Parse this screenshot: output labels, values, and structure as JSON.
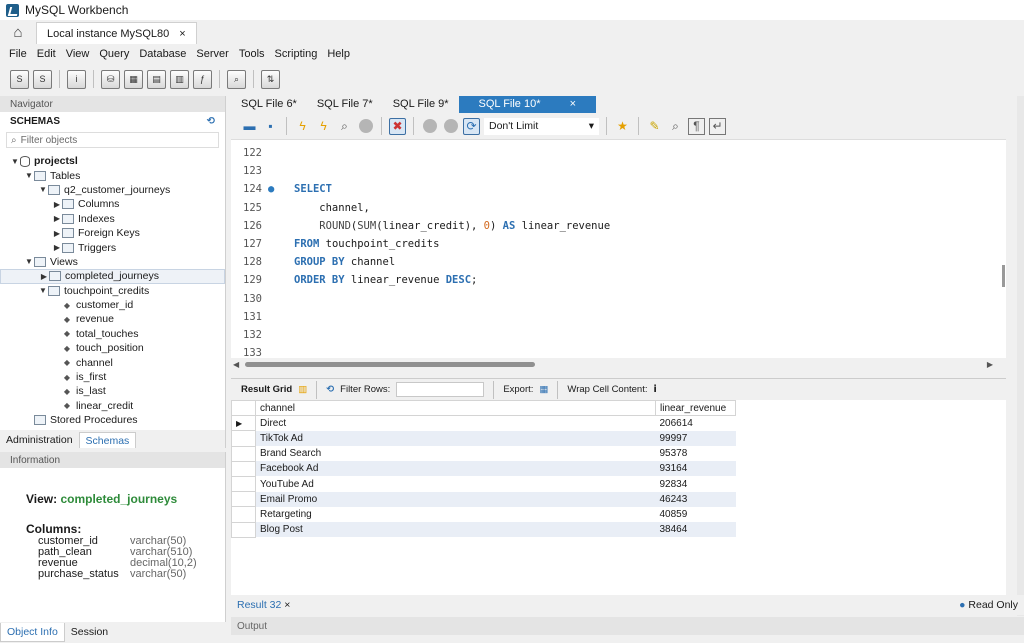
{
  "app": {
    "title": "MySQL Workbench"
  },
  "instance_tab": {
    "label": "Local instance MySQL80",
    "close": "×"
  },
  "menu": [
    "File",
    "Edit",
    "View",
    "Query",
    "Database",
    "Server",
    "Tools",
    "Scripting",
    "Help"
  ],
  "navigator": {
    "header": "Navigator",
    "schemas_label": "SCHEMAS",
    "filter_placeholder": "Filter objects",
    "tree": [
      {
        "label": "projectsl",
        "level": 0,
        "twisty": "▼",
        "icon": "database-icon",
        "bold": true
      },
      {
        "label": "Tables",
        "level": 1,
        "twisty": "▼",
        "icon": "folder-icon"
      },
      {
        "label": "q2_customer_journeys",
        "level": 2,
        "twisty": "▼",
        "icon": "table-icon"
      },
      {
        "label": "Columns",
        "level": 3,
        "twisty": "▶",
        "icon": "folder-icon"
      },
      {
        "label": "Indexes",
        "level": 3,
        "twisty": "▶",
        "icon": "folder-icon"
      },
      {
        "label": "Foreign Keys",
        "level": 3,
        "twisty": "▶",
        "icon": "folder-icon"
      },
      {
        "label": "Triggers",
        "level": 3,
        "twisty": "▶",
        "icon": "folder-icon"
      },
      {
        "label": "Views",
        "level": 1,
        "twisty": "▼",
        "icon": "folder-icon"
      },
      {
        "label": "completed_journeys",
        "level": 2,
        "twisty": "▶",
        "icon": "view-icon",
        "selected": true
      },
      {
        "label": "touchpoint_credits",
        "level": 2,
        "twisty": "▼",
        "icon": "view-icon"
      },
      {
        "label": "customer_id",
        "level": 3,
        "icon": "column-icon"
      },
      {
        "label": "revenue",
        "level": 3,
        "icon": "column-icon"
      },
      {
        "label": "total_touches",
        "level": 3,
        "icon": "column-icon"
      },
      {
        "label": "touch_position",
        "level": 3,
        "icon": "column-icon"
      },
      {
        "label": "channel",
        "level": 3,
        "icon": "column-icon"
      },
      {
        "label": "is_first",
        "level": 3,
        "icon": "column-icon"
      },
      {
        "label": "is_last",
        "level": 3,
        "icon": "column-icon"
      },
      {
        "label": "linear_credit",
        "level": 3,
        "icon": "column-icon"
      },
      {
        "label": "Stored Procedures",
        "level": 1,
        "icon": "folder-icon"
      }
    ],
    "tabs": {
      "administration": "Administration",
      "schemas": "Schemas"
    }
  },
  "information": {
    "header": "Information",
    "view_prefix": "View:",
    "view_name": "completed_journeys",
    "columns_label": "Columns:",
    "columns": [
      {
        "name": "customer_id",
        "type": "varchar(50)"
      },
      {
        "name": "path_clean",
        "type": "varchar(510)"
      },
      {
        "name": "revenue",
        "type": "decimal(10,2)"
      },
      {
        "name": "purchase_status",
        "type": "varchar(50)"
      }
    ],
    "tabs": {
      "object_info": "Object Info",
      "session": "Session"
    }
  },
  "sql_tabs": [
    {
      "label": "SQL File 6*",
      "active": false
    },
    {
      "label": "SQL File 7*",
      "active": false
    },
    {
      "label": "SQL File 9*",
      "active": false
    },
    {
      "label": "SQL File 10*",
      "active": true
    }
  ],
  "sql_tab_close": "×",
  "editor_toolbar": {
    "limit": "Don't Limit"
  },
  "editor": {
    "lines": [
      {
        "n": "122",
        "code": ""
      },
      {
        "n": "123",
        "code": ""
      },
      {
        "n": "124",
        "marker": "●",
        "code": "SELECT"
      },
      {
        "n": "125",
        "code": "    channel,"
      },
      {
        "n": "126",
        "code": "    ROUND(SUM(linear_credit), 0) AS linear_revenue"
      },
      {
        "n": "127",
        "code": "FROM touchpoint_credits"
      },
      {
        "n": "128",
        "code": "GROUP BY channel"
      },
      {
        "n": "129",
        "code": "ORDER BY linear_revenue DESC;"
      },
      {
        "n": "130",
        "code": ""
      },
      {
        "n": "131",
        "code": ""
      },
      {
        "n": "132",
        "code": ""
      },
      {
        "n": "133",
        "code": ""
      }
    ]
  },
  "result_toolbar": {
    "result_grid": "Result Grid",
    "filter_rows": "Filter Rows:",
    "export": "Export:",
    "wrap": "Wrap Cell Content:"
  },
  "result": {
    "columns": [
      "channel",
      "linear_revenue"
    ],
    "rows": [
      [
        "Direct",
        "206614"
      ],
      [
        "TikTok Ad",
        "99997"
      ],
      [
        "Brand Search",
        "95378"
      ],
      [
        "Facebook Ad",
        "93164"
      ],
      [
        "YouTube Ad",
        "92834"
      ],
      [
        "Email Promo",
        "46243"
      ],
      [
        "Retargeting",
        "40859"
      ],
      [
        "Blog Post",
        "38464"
      ]
    ]
  },
  "result_tab": {
    "label": "Result 32",
    "close": "×",
    "status": "Read Only"
  },
  "output": {
    "label": "Output"
  },
  "colors": {
    "accent": "#2c7bbf",
    "keyword": "#2c6fb1",
    "number": "#d2691e",
    "view_name": "#2e8b3a"
  }
}
